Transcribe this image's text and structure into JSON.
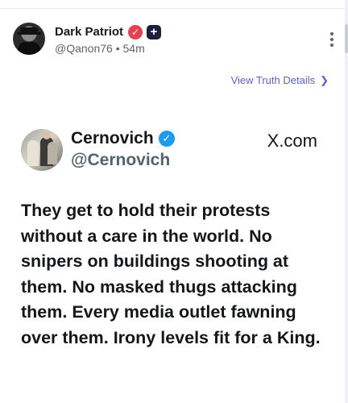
{
  "post": {
    "author_name": "Dark Patriot",
    "verified_icon": "verified-badge-icon",
    "plus_icon": "plus-badge-icon",
    "handle": "@Qanon76",
    "separator": "•",
    "time_ago": "54m",
    "view_details": "View Truth Details",
    "view_details_chevron": "❯"
  },
  "embed": {
    "author_name": "Cernovich",
    "handle": "@Cernovich",
    "source": "X.com",
    "text": "They get to hold their protests without a care in the world. No snipers on buildings shooting at them. No masked thugs attacking them. Every media outlet fawning over them. Irony levels fit for a King."
  },
  "colors": {
    "accent": "#5b5fd6",
    "verified_red": "#e8404e",
    "verified_blue": "#1d9bf0"
  }
}
